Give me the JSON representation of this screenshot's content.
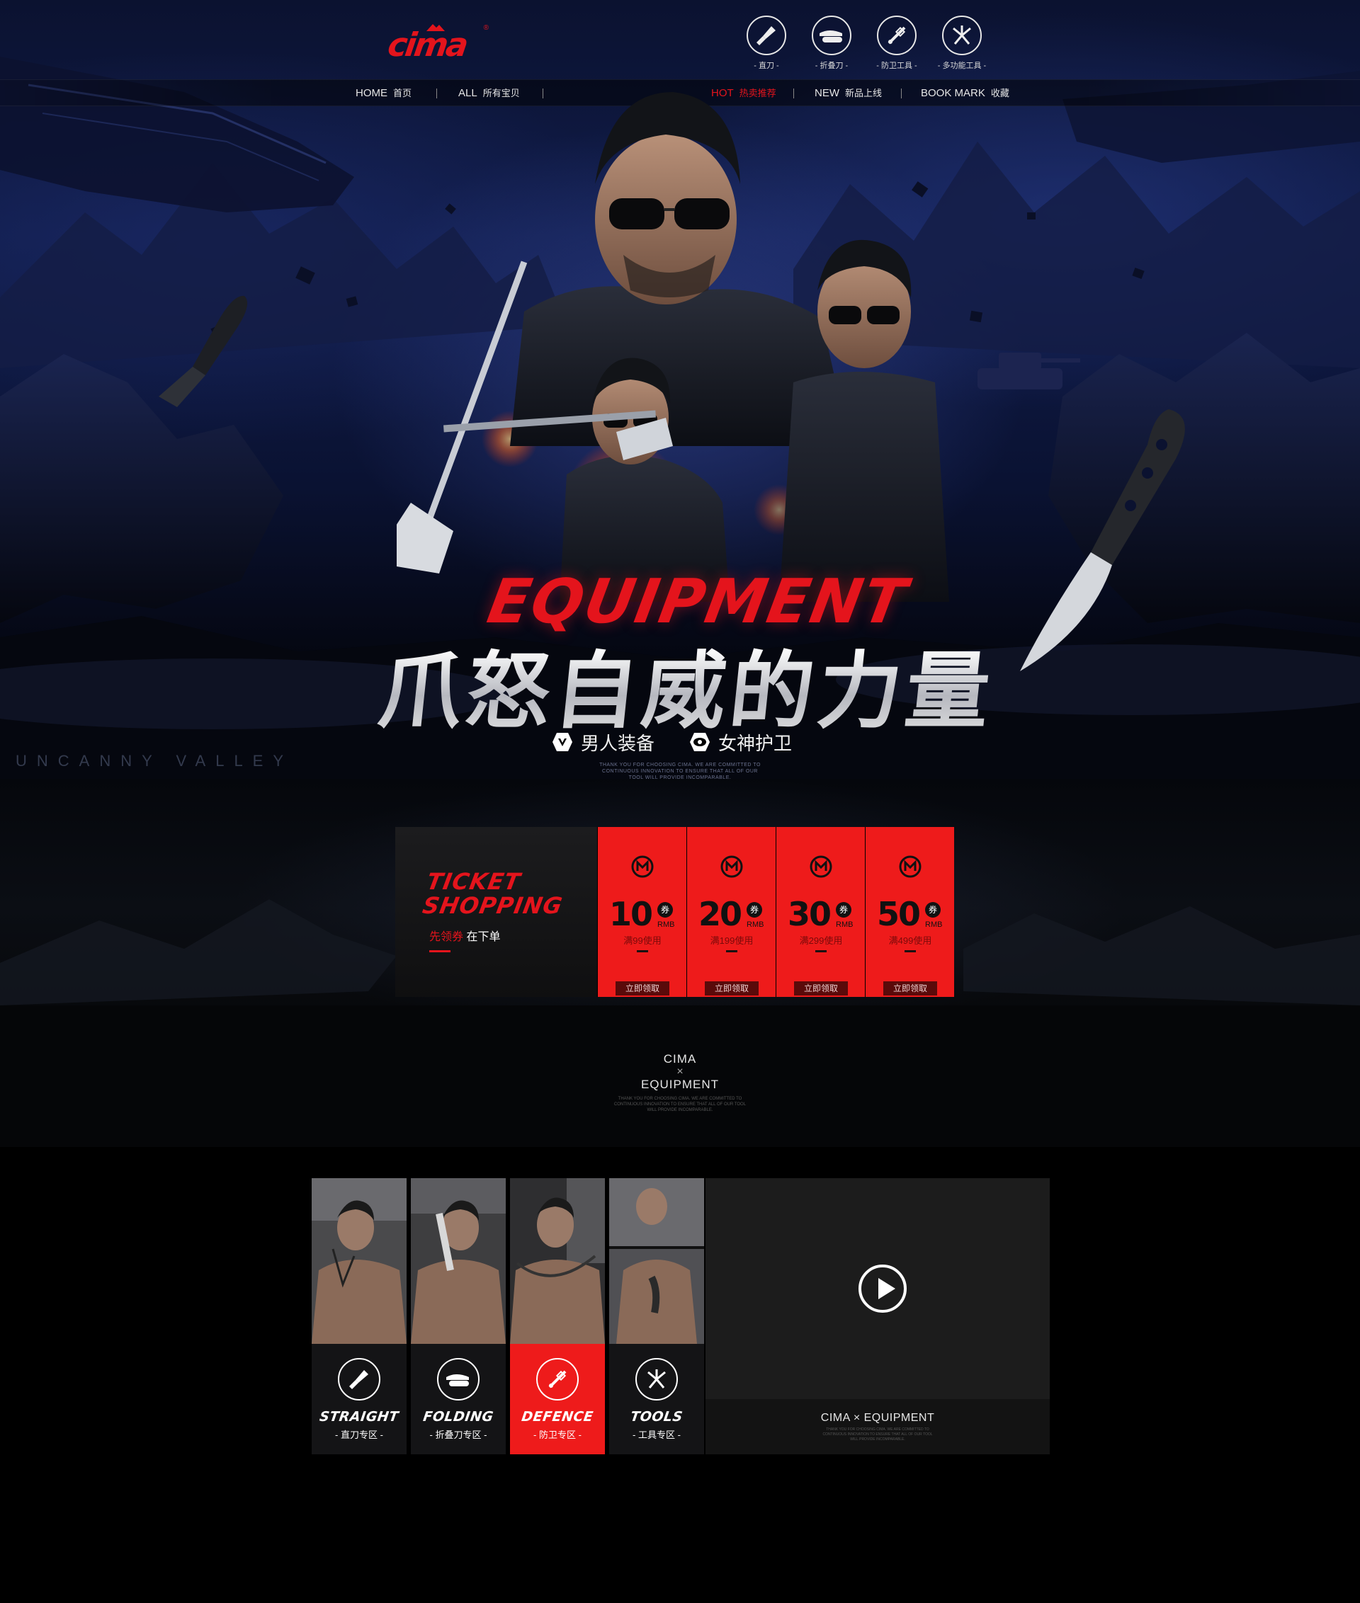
{
  "header": {
    "logo_text": "cima",
    "categories": [
      {
        "label": "- 直刀 -",
        "icon": "straight-knife-icon"
      },
      {
        "label": "- 折叠刀 -",
        "icon": "folding-knife-icon"
      },
      {
        "label": "- 防卫工具 -",
        "icon": "defence-tool-icon"
      },
      {
        "label": "- 多功能工具 -",
        "icon": "multi-tool-icon"
      }
    ]
  },
  "nav": {
    "items": [
      {
        "en": "HOME",
        "cn": "首页"
      },
      {
        "en": "ALL",
        "cn": "所有宝贝"
      },
      {
        "en": "HOT",
        "cn": "热卖推荐"
      },
      {
        "en": "NEW",
        "cn": "新品上线"
      },
      {
        "en": "BOOK MARK",
        "cn": "收藏"
      }
    ],
    "separator": "|"
  },
  "hero": {
    "equipment_word": "EQUIPMENT",
    "slogan": "爪怒自威的力量",
    "tags": [
      {
        "label": "男人装备",
        "icon": "shield-icon"
      },
      {
        "label": "女神护卫",
        "icon": "eye-shield-icon"
      }
    ],
    "small_text": "THANK YOU FOR CHOOSING CIMA. WE ARE COMMITTED TO CONTINUOUS INNOVATION TO ENSURE THAT ALL OF OUR TOOL WILL PROVIDE INCOMPARABLE.",
    "side_text": "UNCANNY VALLEY"
  },
  "coupons": {
    "title_line1": "TICKET",
    "title_line2": "SHOPPING",
    "sub_red": "先领券",
    "sub_white": "在下单",
    "quan": "券",
    "rmb": "RMB",
    "button_label": "立即领取",
    "items": [
      {
        "value": "10",
        "condition": "满99使用"
      },
      {
        "value": "20",
        "condition": "满199使用"
      },
      {
        "value": "30",
        "condition": "满299使用"
      },
      {
        "value": "50",
        "condition": "满499使用"
      }
    ]
  },
  "section": {
    "line1": "CIMA",
    "cross": "×",
    "line2": "EQUIPMENT",
    "small_text": "THANK YOU FOR CHOOSING CIMA. WE ARE COMMITTED TO CONTINUOUS INNOVATION TO ENSURE THAT ALL OF OUR TOOL WILL PROVIDE INCOMPARABLE."
  },
  "product_categories": [
    {
      "en": "STRAIGHT",
      "cn": "- 直刀专区 -",
      "icon": "straight-knife-icon",
      "active": false
    },
    {
      "en": "FOLDING",
      "cn": "- 折叠刀专区 -",
      "icon": "folding-knife-icon",
      "active": false
    },
    {
      "en": "DEFENCE",
      "cn": "- 防卫专区 -",
      "icon": "defence-tool-icon",
      "active": true
    },
    {
      "en": "TOOLS",
      "cn": "- 工具专区 -",
      "icon": "multi-tool-icon",
      "active": false
    }
  ],
  "video": {
    "caption": "CIMA × EQUIPMENT",
    "small_text": "THANK YOU FOR CHOOSING CIMA. WE ARE COMMITTED TO CONTINUOUS INNOVATION TO ENSURE THAT ALL OF OUR TOOL WILL PROVIDE INCOMPARABLE.",
    "icon": "play-icon"
  },
  "colors": {
    "accent": "#e4141c",
    "coupon": "#ee1b1b",
    "background": "#000000",
    "hero_blue": "#101c4a"
  }
}
